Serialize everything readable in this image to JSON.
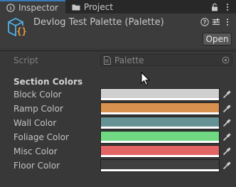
{
  "tabs": [
    {
      "label": "Inspector",
      "icon": "info-icon",
      "active": true
    },
    {
      "label": "Project",
      "icon": "folder-icon",
      "active": false
    }
  ],
  "header": {
    "title": "Devlog Test Palette (Palette)",
    "open_label": "Open",
    "asset_icon": "scriptable-object-icon"
  },
  "script_field": {
    "label": "Script",
    "value": "Palette"
  },
  "section": {
    "title": "Section Colors"
  },
  "colors": [
    {
      "label": "Block Color",
      "hex": "#cfcfcf"
    },
    {
      "label": "Ramp Color",
      "hex": "#d8914f"
    },
    {
      "label": "Wall Color",
      "hex": "#669295"
    },
    {
      "label": "Foliage Color",
      "hex": "#70d882"
    },
    {
      "label": "Misc Color",
      "hex": "#e26565"
    },
    {
      "label": "Floor Color",
      "hex": "#3f3f3f"
    }
  ],
  "theme": {
    "accent": "#3a79bb",
    "panel_bg": "#383838"
  }
}
